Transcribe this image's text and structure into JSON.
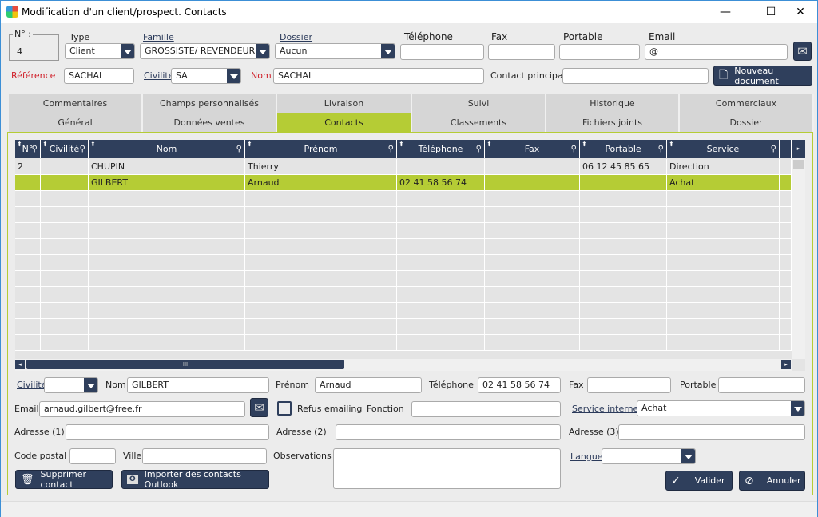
{
  "window": {
    "title": "Modification d'un client/prospect. Contacts",
    "minimize": "—",
    "maximize": "☐",
    "close": "✕"
  },
  "header": {
    "numero_label": "N° :",
    "numero_value": "4",
    "type_label": "Type",
    "type_value": "Client",
    "famille_label": "Famille",
    "famille_value": "GROSSISTE/ REVENDEUR",
    "dossier_label": "Dossier",
    "dossier_value": "Aucun",
    "telephone_label": "Téléphone",
    "telephone_value": "",
    "fax_label": "Fax",
    "fax_value": "",
    "portable_label": "Portable",
    "portable_value": "",
    "email_label": "Email",
    "email_value": "@",
    "reference_label": "Référence",
    "reference_value": "SACHAL",
    "civilite_label": "Civilité",
    "civilite_value": "SA",
    "nom_label": "Nom",
    "nom_value": "SACHAL",
    "contact_principal_label": "Contact principal",
    "contact_principal_value": "",
    "nouveau_document": "Nouveau document"
  },
  "tabs_row1": [
    "Commentaires",
    "Champs personnalisés",
    "Livraison",
    "Suivi",
    "Historique",
    "Commerciaux"
  ],
  "tabs_row2": [
    "Général",
    "Données ventes",
    "Contacts",
    "Classements",
    "Fichiers joints",
    "Dossier"
  ],
  "active_tab": "Contacts",
  "grid": {
    "columns": [
      "N°",
      "Civilité",
      "Nom",
      "Prénom",
      "Téléphone",
      "Fax",
      "Portable",
      "Service"
    ],
    "rows": [
      [
        "2",
        "",
        "CHUPIN",
        "Thierry",
        "",
        "",
        "06 12 45 85 65",
        "Direction"
      ],
      [
        "",
        "",
        "GILBERT",
        "Arnaud",
        "02 41 58 56 74",
        "",
        "",
        "Achat"
      ]
    ],
    "selected_row": 1,
    "hscroll_grip": "III"
  },
  "form": {
    "civilite_label": "Civilité",
    "civilite_value": "",
    "nom_label": "Nom",
    "nom_value": "GILBERT",
    "prenom_label": "Prénom",
    "prenom_value": "Arnaud",
    "telephone_label": "Téléphone",
    "telephone_value": "02 41 58 56 74",
    "fax_label": "Fax",
    "fax_value": "",
    "portable_label": "Portable",
    "portable_value": "",
    "email_label": "Email",
    "email_value": "arnaud.gilbert@free.fr",
    "refus_emailing_label": "Refus emailing",
    "refus_emailing_checked": false,
    "fonction_label": "Fonction",
    "fonction_value": "",
    "service_interne_label": "Service interne",
    "service_interne_value": "Achat",
    "adresse1_label": "Adresse (1)",
    "adresse2_label": "Adresse (2)",
    "adresse3_label": "Adresse (3)",
    "code_postal_label": "Code postal",
    "ville_label": "Ville",
    "observations_label": "Observations",
    "langue_label": "Langue",
    "langue_value": "",
    "supprimer": "Supprimer contact",
    "importer": "Importer des contacts Outlook",
    "valider": "Valider",
    "annuler": "Annuler"
  },
  "colors": {
    "accent": "#b5cc35",
    "dark": "#2f3f5c",
    "required": "#d0202a"
  }
}
